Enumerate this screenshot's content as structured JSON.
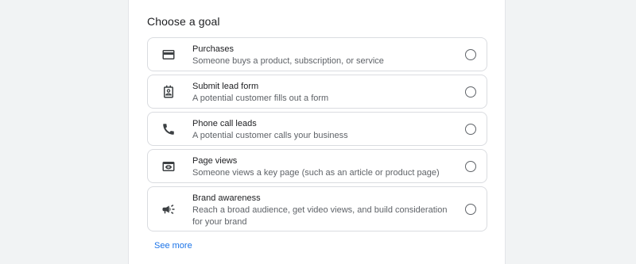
{
  "section_title": "Choose a goal",
  "goals": [
    {
      "name": "Purchases",
      "description": "Someone buys a product, subscription, or service",
      "icon": "credit-card-icon",
      "selected": false
    },
    {
      "name": "Submit lead form",
      "description": "A potential customer fills out a form",
      "icon": "contact-form-icon",
      "selected": false
    },
    {
      "name": "Phone call leads",
      "description": "A potential customer calls your business",
      "icon": "phone-icon",
      "selected": false
    },
    {
      "name": "Page views",
      "description": "Someone views a key page (such as an article or product page)",
      "icon": "eye-page-icon",
      "selected": false
    },
    {
      "name": "Brand awareness",
      "description": "Reach a broad audience, get video views, and build consideration for your brand",
      "icon": "megaphone-icon",
      "selected": false
    }
  ],
  "see_more_label": "See more",
  "colors": {
    "link": "#1a73e8",
    "border": "#dadce0",
    "background": "#f1f3f4"
  }
}
